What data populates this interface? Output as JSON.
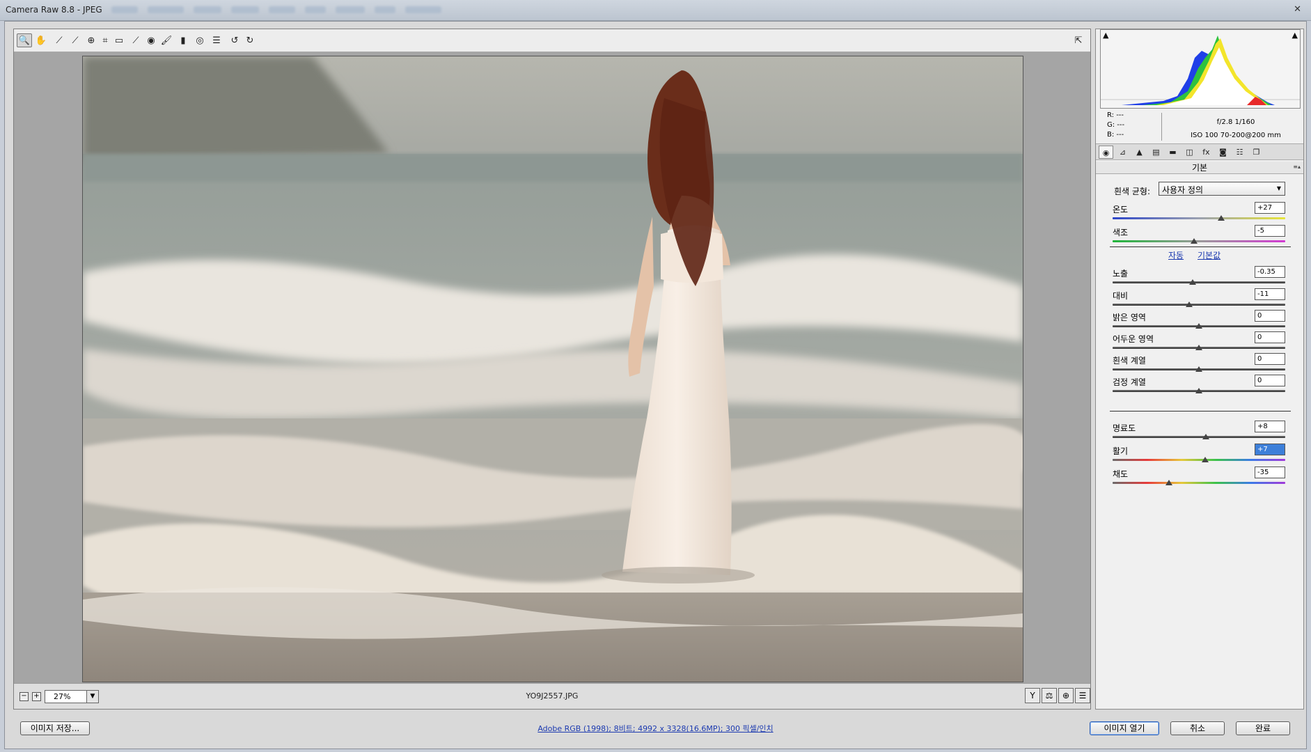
{
  "window": {
    "title": "Camera Raw 8.8  -  JPEG",
    "close_glyph": "✕"
  },
  "toolbar": {
    "tools": [
      {
        "name": "zoom-tool-icon",
        "glyph": "🔍"
      },
      {
        "name": "hand-tool-icon",
        "glyph": "✋"
      },
      {
        "name": "white-balance-tool-icon",
        "glyph": "⟋"
      },
      {
        "name": "color-sampler-tool-icon",
        "glyph": "⟋"
      },
      {
        "name": "targeted-adjustment-tool-icon",
        "glyph": "⊕"
      },
      {
        "name": "crop-tool-icon",
        "glyph": "⌗"
      },
      {
        "name": "straighten-tool-icon",
        "glyph": "▭"
      },
      {
        "name": "spot-removal-tool-icon",
        "glyph": "⟋"
      },
      {
        "name": "red-eye-removal-tool-icon",
        "glyph": "◉"
      },
      {
        "name": "adjustment-brush-icon",
        "glyph": "🖌"
      },
      {
        "name": "graduated-filter-icon",
        "glyph": "▮"
      },
      {
        "name": "radial-filter-icon",
        "glyph": "◎"
      },
      {
        "name": "preferences-icon",
        "glyph": "☰"
      },
      {
        "name": "rotate-left-icon",
        "glyph": "↺"
      },
      {
        "name": "rotate-right-icon",
        "glyph": "↻"
      }
    ],
    "fullscreen_glyph": "⇱"
  },
  "status": {
    "zoom_value": "27%",
    "filename": "YO9J2557.JPG",
    "zoom_out": "−",
    "zoom_in": "+",
    "dropdown_arrow": "▼",
    "icons": [
      "Y",
      "⚖",
      "⊕",
      "☰"
    ]
  },
  "histogram": {
    "shadow_clip_glyph": "▲",
    "highlight_clip_glyph": "▲"
  },
  "rgb": {
    "r": "R:   ---",
    "g": "G:   ---",
    "b": "B:   ---"
  },
  "camera": {
    "line1": "f/2.8    1/160",
    "line2": "ISO 100    70-200@200 mm"
  },
  "panel_tabs": [
    "◉",
    "⊿",
    "▲",
    "▤",
    "▬",
    "◫",
    "fx",
    "◙",
    "☷",
    "❐"
  ],
  "basic": {
    "title": "기본",
    "menu_glyph": "≡▴",
    "wb_label": "흰색 균형:",
    "wb_value": "사용자 정의",
    "wb_arrow": "▼",
    "auto": "자동",
    "default": "기본값",
    "sliders": [
      {
        "label": "온도",
        "value": "+27",
        "pos": 0.63,
        "track": "temp"
      },
      {
        "label": "색조",
        "value": "-5",
        "pos": 0.47,
        "track": "tint"
      },
      {
        "label": "노출",
        "value": "-0.35",
        "pos": 0.465,
        "track": ""
      },
      {
        "label": "대비",
        "value": "-11",
        "pos": 0.445,
        "track": ""
      },
      {
        "label": "밝은 영역",
        "value": "0",
        "pos": 0.5,
        "track": ""
      },
      {
        "label": "어두운 영역",
        "value": "0",
        "pos": 0.5,
        "track": ""
      },
      {
        "label": "흰색 계열",
        "value": "0",
        "pos": 0.5,
        "track": ""
      },
      {
        "label": "검정 계열",
        "value": "0",
        "pos": 0.5,
        "track": ""
      },
      {
        "label": "명료도",
        "value": "+8",
        "pos": 0.54,
        "track": ""
      },
      {
        "label": "활기",
        "value": "+7",
        "pos": 0.535,
        "track": "vib",
        "selected": true
      },
      {
        "label": "채도",
        "value": "-35",
        "pos": 0.325,
        "track": "vib"
      }
    ]
  },
  "bottom": {
    "save_label": "이미지 저장...",
    "workflow": "Adobe RGB (1998); 8비트; 4992 x 3328(16.6MP); 300 픽셀/인치",
    "open_label": "이미지 열기",
    "cancel_label": "취소",
    "done_label": "완료"
  },
  "colors": {
    "accent": "#3d7fd9",
    "link": "#1c3ab0"
  }
}
